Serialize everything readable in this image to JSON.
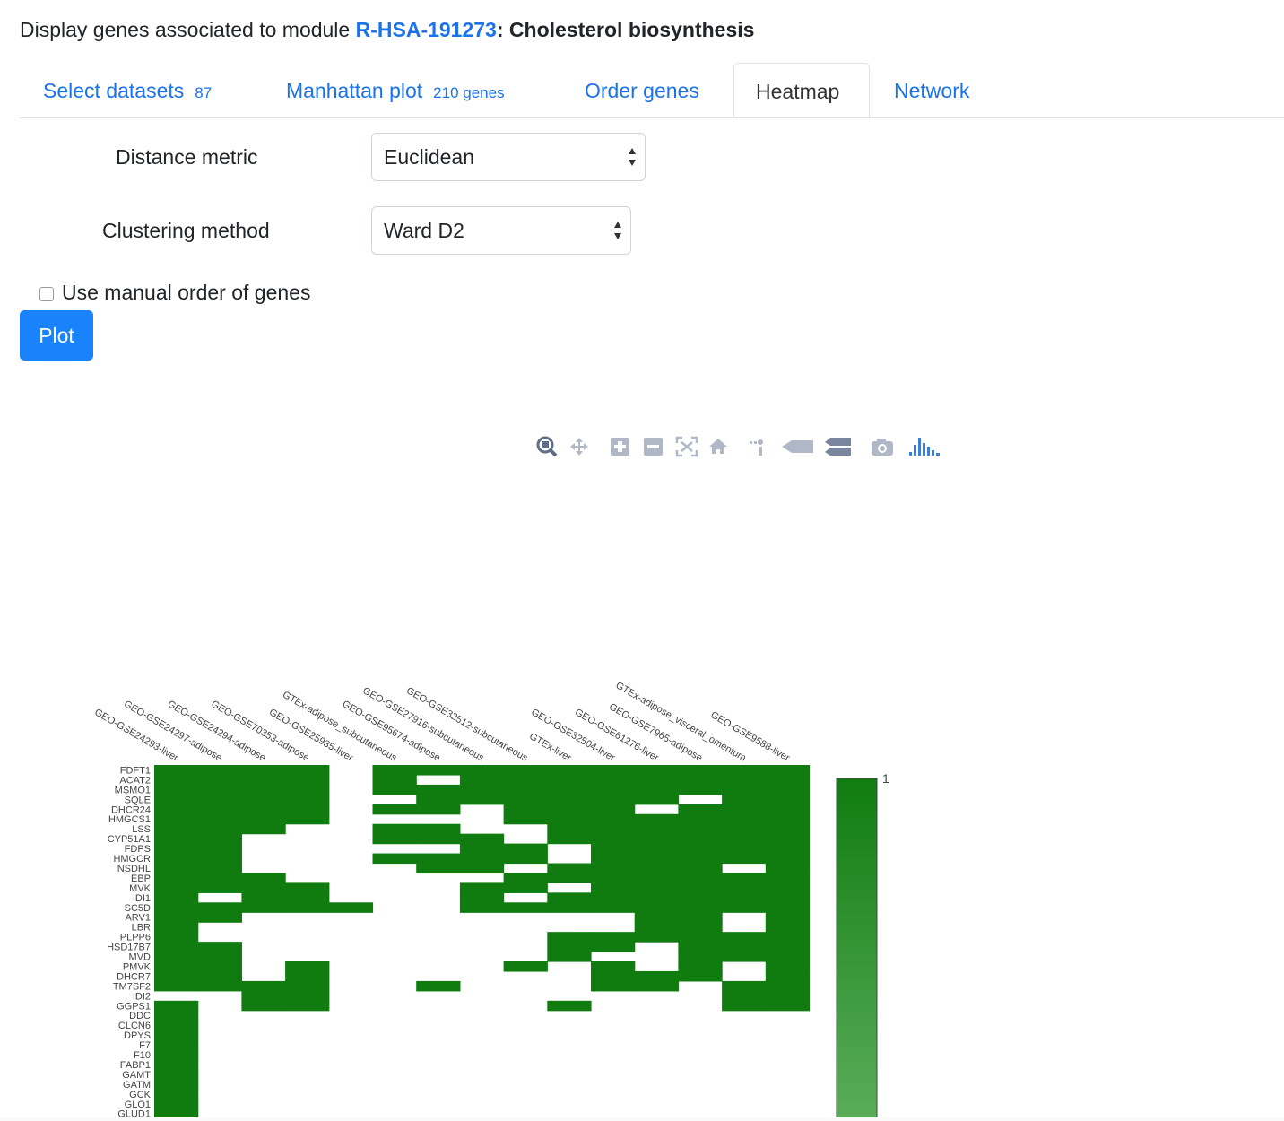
{
  "header": {
    "prefix": "Display genes associated to module ",
    "module_id": "R-HSA-191273",
    "separator": ": ",
    "module_name": "Cholesterol biosynthesis"
  },
  "tabs": [
    {
      "label": "Select datasets",
      "count": "87"
    },
    {
      "label": "Manhattan plot",
      "count": "210 genes"
    },
    {
      "label": "Order genes",
      "count": ""
    },
    {
      "label": "Heatmap",
      "count": ""
    },
    {
      "label": "Network",
      "count": ""
    }
  ],
  "active_tab": "Heatmap",
  "form": {
    "distance_label": "Distance metric",
    "distance_value": "Euclidean",
    "clustering_label": "Clustering method",
    "clustering_value": "Ward D2",
    "manual_order_label": "Use manual order of genes",
    "manual_order_checked": false,
    "plot_button": "Plot"
  },
  "toolbar_icons": [
    "zoom-icon",
    "pan-icon",
    "zoom-in-icon",
    "zoom-out-icon",
    "autoscale-icon",
    "reset-axes-icon",
    "toggle-spike-lines-icon",
    "hover-closest-icon",
    "hover-compare-icon",
    "camera-icon",
    "plotly-logo-icon"
  ],
  "colors": {
    "link": "#1a73e8",
    "button": "#1a82fb",
    "heat_on": "#107c10",
    "heat_off": "#ffffff"
  },
  "chart_data": {
    "type": "heatmap",
    "columns": [
      "GEO-GSE24293-liver",
      "GEO-GSE24297-adipose",
      "GEO-GSE24294-adipose",
      "GEO-GSE70353-adipose",
      "GEO-GSE25935-liver",
      "GTEx-adipose_subcutaneous",
      "GEO-GSE95674-adipose",
      "GEO-GSE27916-subcutaneous",
      "GEO-GSE32512-subcutaneous",
      "GTEx-liver",
      "GEO-GSE32504-liver",
      "GEO-GSE61276-liver",
      "GEO-GSE7965-adipose",
      "GTEx-adipose_visceral_omentum",
      "GEO-GSE9588-liver"
    ],
    "rows": [
      "FDFT1",
      "ACAT2",
      "MSMO1",
      "SQLE",
      "DHCR24",
      "HMGCS1",
      "LSS",
      "CYP51A1",
      "FDPS",
      "HMGCR",
      "NSDHL",
      "EBP",
      "MVK",
      "IDI1",
      "SC5D",
      "ARV1",
      "LBR",
      "PLPP6",
      "HSD17B7",
      "MVD",
      "PMVK",
      "DHCR7",
      "TM7SF2",
      "IDI2",
      "GGPS1",
      "DDC",
      "CLCN6",
      "DPYS",
      "F7",
      "F10",
      "FABP1",
      "GAMT",
      "GATM",
      "GCK",
      "GLO1",
      "GLUD1"
    ],
    "matrix": [
      [
        1,
        1,
        1,
        1,
        0,
        1,
        1,
        1,
        1,
        1,
        1,
        1,
        1,
        1,
        1
      ],
      [
        1,
        1,
        1,
        1,
        0,
        1,
        0,
        1,
        1,
        1,
        1,
        1,
        1,
        1,
        1
      ],
      [
        1,
        1,
        1,
        1,
        0,
        1,
        1,
        1,
        1,
        1,
        1,
        1,
        1,
        1,
        1
      ],
      [
        1,
        1,
        1,
        1,
        0,
        0,
        1,
        1,
        1,
        1,
        1,
        1,
        0,
        1,
        1
      ],
      [
        1,
        1,
        1,
        1,
        0,
        1,
        1,
        0,
        1,
        1,
        1,
        0,
        1,
        1,
        1
      ],
      [
        1,
        1,
        1,
        1,
        0,
        0,
        0,
        0,
        1,
        1,
        1,
        1,
        1,
        1,
        1
      ],
      [
        1,
        1,
        1,
        0,
        0,
        1,
        1,
        0,
        0,
        1,
        1,
        1,
        1,
        1,
        1
      ],
      [
        1,
        1,
        0,
        0,
        0,
        1,
        1,
        1,
        0,
        1,
        1,
        1,
        1,
        1,
        1
      ],
      [
        1,
        1,
        0,
        0,
        0,
        0,
        0,
        1,
        1,
        0,
        1,
        1,
        1,
        1,
        1
      ],
      [
        1,
        1,
        0,
        0,
        0,
        1,
        1,
        1,
        1,
        0,
        1,
        1,
        1,
        1,
        1
      ],
      [
        1,
        1,
        0,
        0,
        0,
        0,
        1,
        1,
        0,
        1,
        1,
        1,
        1,
        0,
        1
      ],
      [
        1,
        1,
        1,
        0,
        0,
        0,
        0,
        0,
        1,
        1,
        1,
        1,
        1,
        1,
        1
      ],
      [
        1,
        1,
        1,
        1,
        0,
        0,
        0,
        1,
        1,
        0,
        1,
        1,
        1,
        1,
        1
      ],
      [
        1,
        0,
        1,
        1,
        0,
        0,
        0,
        1,
        0,
        1,
        1,
        1,
        1,
        1,
        1
      ],
      [
        1,
        1,
        1,
        1,
        1,
        0,
        0,
        1,
        1,
        1,
        1,
        1,
        1,
        1,
        1
      ],
      [
        1,
        1,
        0,
        0,
        0,
        0,
        0,
        0,
        0,
        0,
        0,
        1,
        1,
        0,
        1
      ],
      [
        1,
        0,
        0,
        0,
        0,
        0,
        0,
        0,
        0,
        0,
        0,
        1,
        1,
        0,
        1
      ],
      [
        1,
        0,
        0,
        0,
        0,
        0,
        0,
        0,
        0,
        1,
        1,
        1,
        1,
        1,
        1
      ],
      [
        1,
        1,
        0,
        0,
        0,
        0,
        0,
        0,
        0,
        1,
        1,
        0,
        1,
        1,
        1
      ],
      [
        1,
        1,
        0,
        0,
        0,
        0,
        0,
        0,
        0,
        1,
        0,
        0,
        1,
        1,
        1
      ],
      [
        1,
        1,
        0,
        1,
        0,
        0,
        0,
        0,
        1,
        0,
        1,
        0,
        1,
        0,
        1
      ],
      [
        1,
        1,
        0,
        1,
        0,
        0,
        0,
        0,
        0,
        0,
        1,
        1,
        1,
        0,
        1
      ],
      [
        1,
        1,
        1,
        1,
        0,
        0,
        1,
        0,
        0,
        0,
        1,
        1,
        0,
        1,
        1
      ],
      [
        0,
        0,
        1,
        1,
        0,
        0,
        0,
        0,
        0,
        0,
        0,
        0,
        0,
        1,
        1
      ],
      [
        1,
        0,
        1,
        1,
        0,
        0,
        0,
        0,
        0,
        1,
        0,
        0,
        0,
        1,
        1
      ],
      [
        1,
        0,
        0,
        0,
        0,
        0,
        0,
        0,
        0,
        0,
        0,
        0,
        0,
        0,
        0
      ],
      [
        1,
        0,
        0,
        0,
        0,
        0,
        0,
        0,
        0,
        0,
        0,
        0,
        0,
        0,
        0
      ],
      [
        1,
        0,
        0,
        0,
        0,
        0,
        0,
        0,
        0,
        0,
        0,
        0,
        0,
        0,
        0
      ],
      [
        1,
        0,
        0,
        0,
        0,
        0,
        0,
        0,
        0,
        0,
        0,
        0,
        0,
        0,
        0
      ],
      [
        1,
        0,
        0,
        0,
        0,
        0,
        0,
        0,
        0,
        0,
        0,
        0,
        0,
        0,
        0
      ],
      [
        1,
        0,
        0,
        0,
        0,
        0,
        0,
        0,
        0,
        0,
        0,
        0,
        0,
        0,
        0
      ],
      [
        1,
        0,
        0,
        0,
        0,
        0,
        0,
        0,
        0,
        0,
        0,
        0,
        0,
        0,
        0
      ],
      [
        1,
        0,
        0,
        0,
        0,
        0,
        0,
        0,
        0,
        0,
        0,
        0,
        0,
        0,
        0
      ],
      [
        1,
        0,
        0,
        0,
        0,
        0,
        0,
        0,
        0,
        0,
        0,
        0,
        0,
        0,
        0
      ],
      [
        1,
        0,
        0,
        0,
        0,
        0,
        0,
        0,
        0,
        0,
        0,
        0,
        0,
        0,
        0
      ],
      [
        1,
        0,
        0,
        0,
        0,
        0,
        0,
        0,
        0,
        0,
        0,
        0,
        0,
        0,
        0
      ]
    ],
    "colorscale": {
      "min_color": "#ffffff",
      "max_color": "#107c10"
    },
    "colorbar_tick_labels": [
      "1"
    ]
  }
}
